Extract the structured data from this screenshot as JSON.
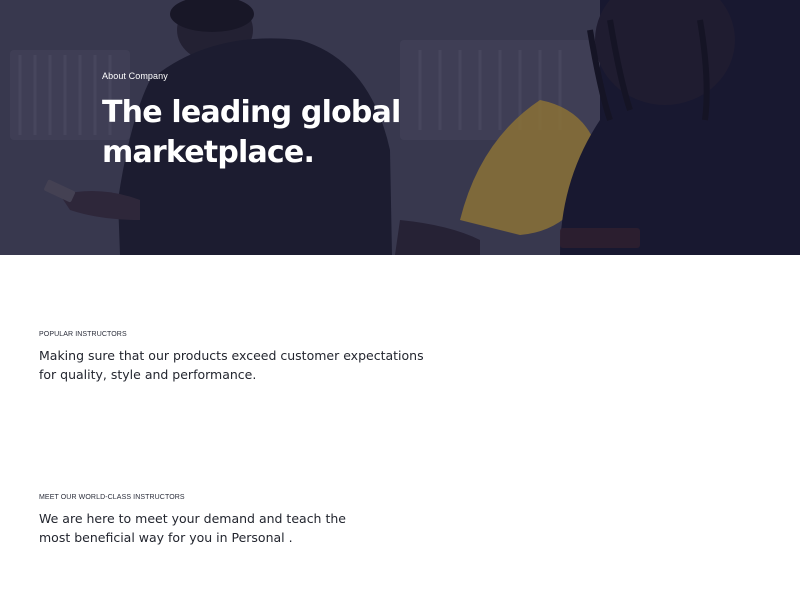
{
  "hero": {
    "eyebrow": "About Company",
    "title": "The leading global marketplace."
  },
  "sections": [
    {
      "eyebrow": "POPULAR INSTRUCTORS",
      "lead": "Making sure that our products exceed customer expectations for quality, style and performance."
    },
    {
      "eyebrow": "MEET OUR WORLD-CLASS INSTRUCTORS",
      "lead": "We are here to meet your demand and teach the most beneficial way for you in Personal ."
    }
  ],
  "colors": {
    "hero_overlay": "#2f2e45",
    "text_dark": "#23262f",
    "accent_yellow": "#c9a23a"
  }
}
